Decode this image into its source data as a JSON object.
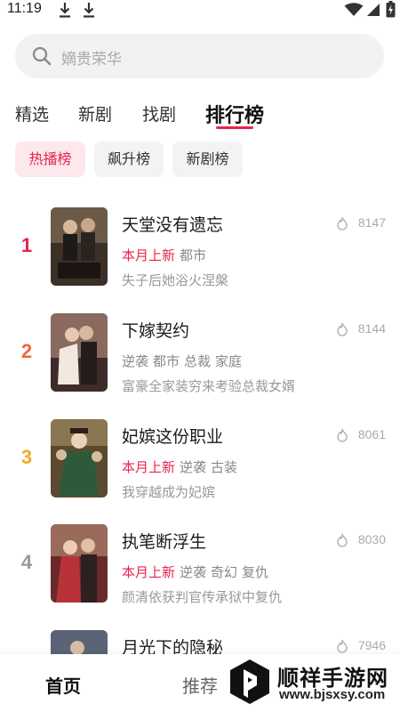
{
  "status_bar": {
    "time": "11:19",
    "icons": [
      "download-icon",
      "download-icon",
      "wifi-icon",
      "signal-icon",
      "battery-icon"
    ]
  },
  "search": {
    "placeholder": "嫡贵荣华"
  },
  "tabs": [
    {
      "label": "精选",
      "active": false
    },
    {
      "label": "新剧",
      "active": false
    },
    {
      "label": "找剧",
      "active": false
    },
    {
      "label": "排行榜",
      "active": true
    }
  ],
  "chips": [
    {
      "label": "热播榜",
      "active": true
    },
    {
      "label": "飙升榜",
      "active": false
    },
    {
      "label": "新剧榜",
      "active": false
    }
  ],
  "rankings": [
    {
      "rank": "1",
      "rank_color": "#e8244d",
      "title": "天堂没有遗忘",
      "is_new": "本月上新",
      "tags": [
        "都市"
      ],
      "desc": "失子后她浴火涅槃",
      "heat": "8147"
    },
    {
      "rank": "2",
      "rank_color": "#f0683a",
      "title": "下嫁契约",
      "is_new": "",
      "tags": [
        "逆袭",
        "都市",
        "总裁",
        "家庭"
      ],
      "desc": "富豪全家装穷来考验总裁女婿",
      "heat": "8144"
    },
    {
      "rank": "3",
      "rank_color": "#f5a623",
      "title": "妃嫔这份职业",
      "is_new": "本月上新",
      "tags": [
        "逆袭",
        "古装"
      ],
      "desc": "我穿越成为妃嫔",
      "heat": "8061"
    },
    {
      "rank": "4",
      "rank_color": "#999999",
      "title": "执笔断浮生",
      "is_new": "本月上新",
      "tags": [
        "逆袭",
        "奇幻",
        "复仇"
      ],
      "desc": "颜清依获判官传承狱中复仇",
      "heat": "8030"
    },
    {
      "rank": "",
      "rank_color": "#999999",
      "title": "月光下的隐秘",
      "is_new": "",
      "tags": [],
      "desc": "",
      "heat": "7946"
    }
  ],
  "bottom_nav": [
    {
      "label": "首页",
      "active": true
    },
    {
      "label": "推荐",
      "active": false
    }
  ],
  "watermark": {
    "name": "顺祥手游网",
    "url": "www.bjsxsy.com"
  },
  "colors": {
    "accent": "#e8244d",
    "chip_active_bg": "#fde8ec",
    "search_bg": "#f2f2f2"
  }
}
